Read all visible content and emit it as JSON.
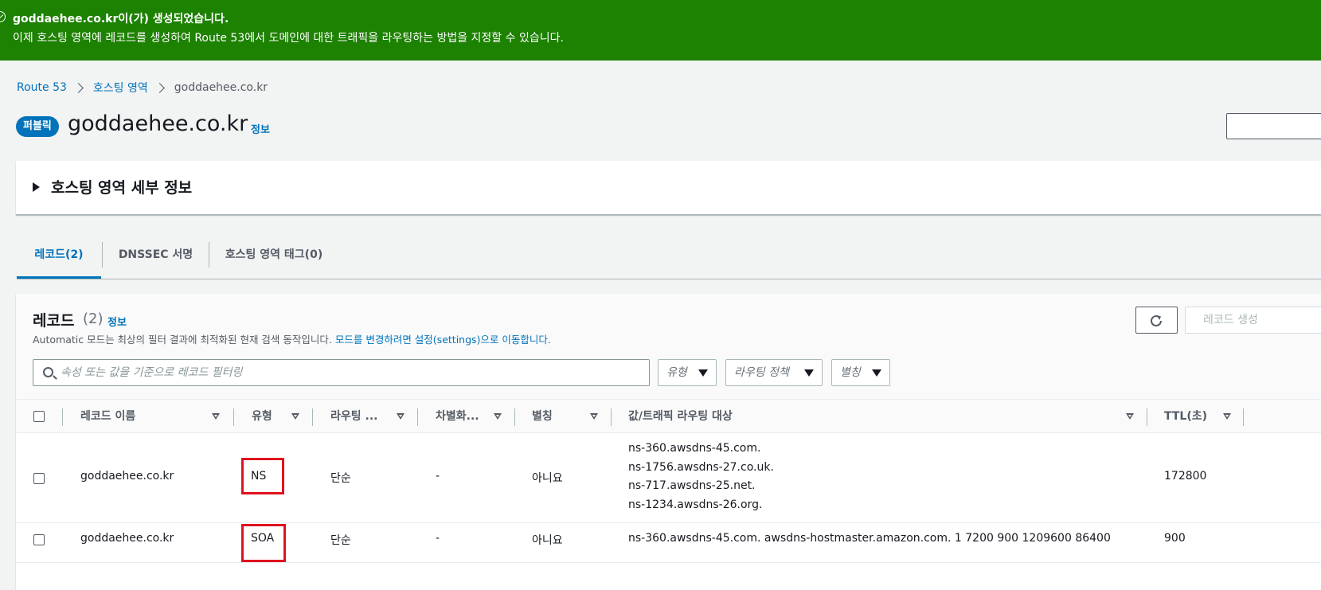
{
  "flash": {
    "title": "goddaehee.co.kr이(가) 생성되었습니다.",
    "message": "이제 호스팅 영역에 레코드를 생성하여 Route 53에서 도메인에 대한 트래픽을 라우팅하는 방법을 지정할 수 있습니다.",
    "color": "#1d8102"
  },
  "breadcrumb": [
    "Route 53",
    "호스팅 영역",
    "goddaehee.co.kr"
  ],
  "header": {
    "badge": "퍼블릭",
    "title": "goddaehee.co.kr",
    "info": "정보"
  },
  "details_panel": {
    "label": "호스팅 영역 세부 정보"
  },
  "tabs": [
    "레코드(2)",
    "DNSSEC 서명",
    "호스팅 영역 태그(0)"
  ],
  "records": {
    "title": "레코드",
    "count": "(2)",
    "info": "정보",
    "desc": "Automatic 모드는 최상의 필터 결과에 최적화된 현재 검색 동작입니다.",
    "desc_link": "모드를 변경하려면 설정(settings)으로 이동합니다.",
    "create_label": "레코드 생성",
    "search_placeholder": "속성 또는 값을 기준으로 레코드 필터링",
    "filters": [
      "유형",
      "라우팅 정책",
      "별칭"
    ],
    "columns": [
      "레코드 이름",
      "유형",
      "라우팅 ...",
      "차별화...",
      "별칭",
      "값/트래픽 라우팅 대상",
      "TTL(초)"
    ],
    "rows": [
      {
        "name": "goddaehee.co.kr",
        "type": "NS",
        "routing": "단순",
        "diff": "-",
        "alias": "아니요",
        "values": [
          "ns-360.awsdns-45.com.",
          "ns-1756.awsdns-27.co.uk.",
          "ns-717.awsdns-25.net.",
          "ns-1234.awsdns-26.org."
        ],
        "ttl": "172800"
      },
      {
        "name": "goddaehee.co.kr",
        "type": "SOA",
        "routing": "단순",
        "diff": "-",
        "alias": "아니요",
        "values": [
          "ns-360.awsdns-45.com. awsdns-hostmaster.amazon.com. 1 7200 900 1209600 86400"
        ],
        "ttl": "900"
      }
    ]
  },
  "icons": {
    "flash": "check-circle-icon",
    "refresh": "refresh-icon",
    "search": "search-icon"
  },
  "colors": {
    "link": "#0073bb",
    "highlight": "#e0121e"
  }
}
